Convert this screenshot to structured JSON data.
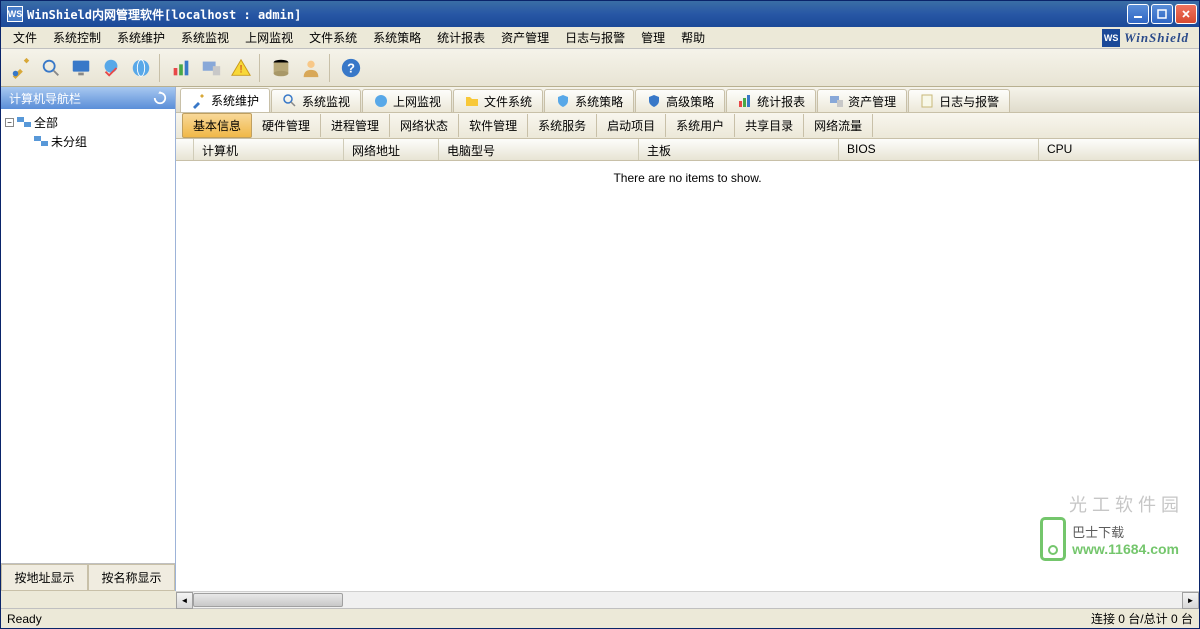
{
  "window": {
    "title": "WinShield内网管理软件[localhost : admin]",
    "brand_text": "WinShield",
    "brand_icon_text": "WS"
  },
  "menu": {
    "items": [
      "文件",
      "系统控制",
      "系统维护",
      "系统监视",
      "上网监视",
      "文件系统",
      "系统策略",
      "统计报表",
      "资产管理",
      "日志与报警",
      "管理",
      "帮助"
    ]
  },
  "sidebar": {
    "header": "计算机导航栏",
    "tree": {
      "root_label": "全部",
      "child_label": "未分组"
    },
    "bottom_tabs": [
      "按地址显示",
      "按名称显示"
    ]
  },
  "main_tabs": [
    "系统维护",
    "系统监视",
    "上网监视",
    "文件系统",
    "系统策略",
    "高级策略",
    "统计报表",
    "资产管理",
    "日志与报警"
  ],
  "sub_tabs": [
    "基本信息",
    "硬件管理",
    "进程管理",
    "网络状态",
    "软件管理",
    "系统服务",
    "启动项目",
    "系统用户",
    "共享目录",
    "网络流量"
  ],
  "grid": {
    "columns": [
      "计算机",
      "网络地址",
      "电脑型号",
      "主板",
      "BIOS",
      "CPU"
    ],
    "empty_message": "There are no items to show."
  },
  "statusbar": {
    "left": "Ready",
    "right": "连接 0 台/总计 0 台"
  },
  "watermark": {
    "top_text": "光 工 软 件 园",
    "label": "巴士下载",
    "url": "www.11684.com"
  }
}
